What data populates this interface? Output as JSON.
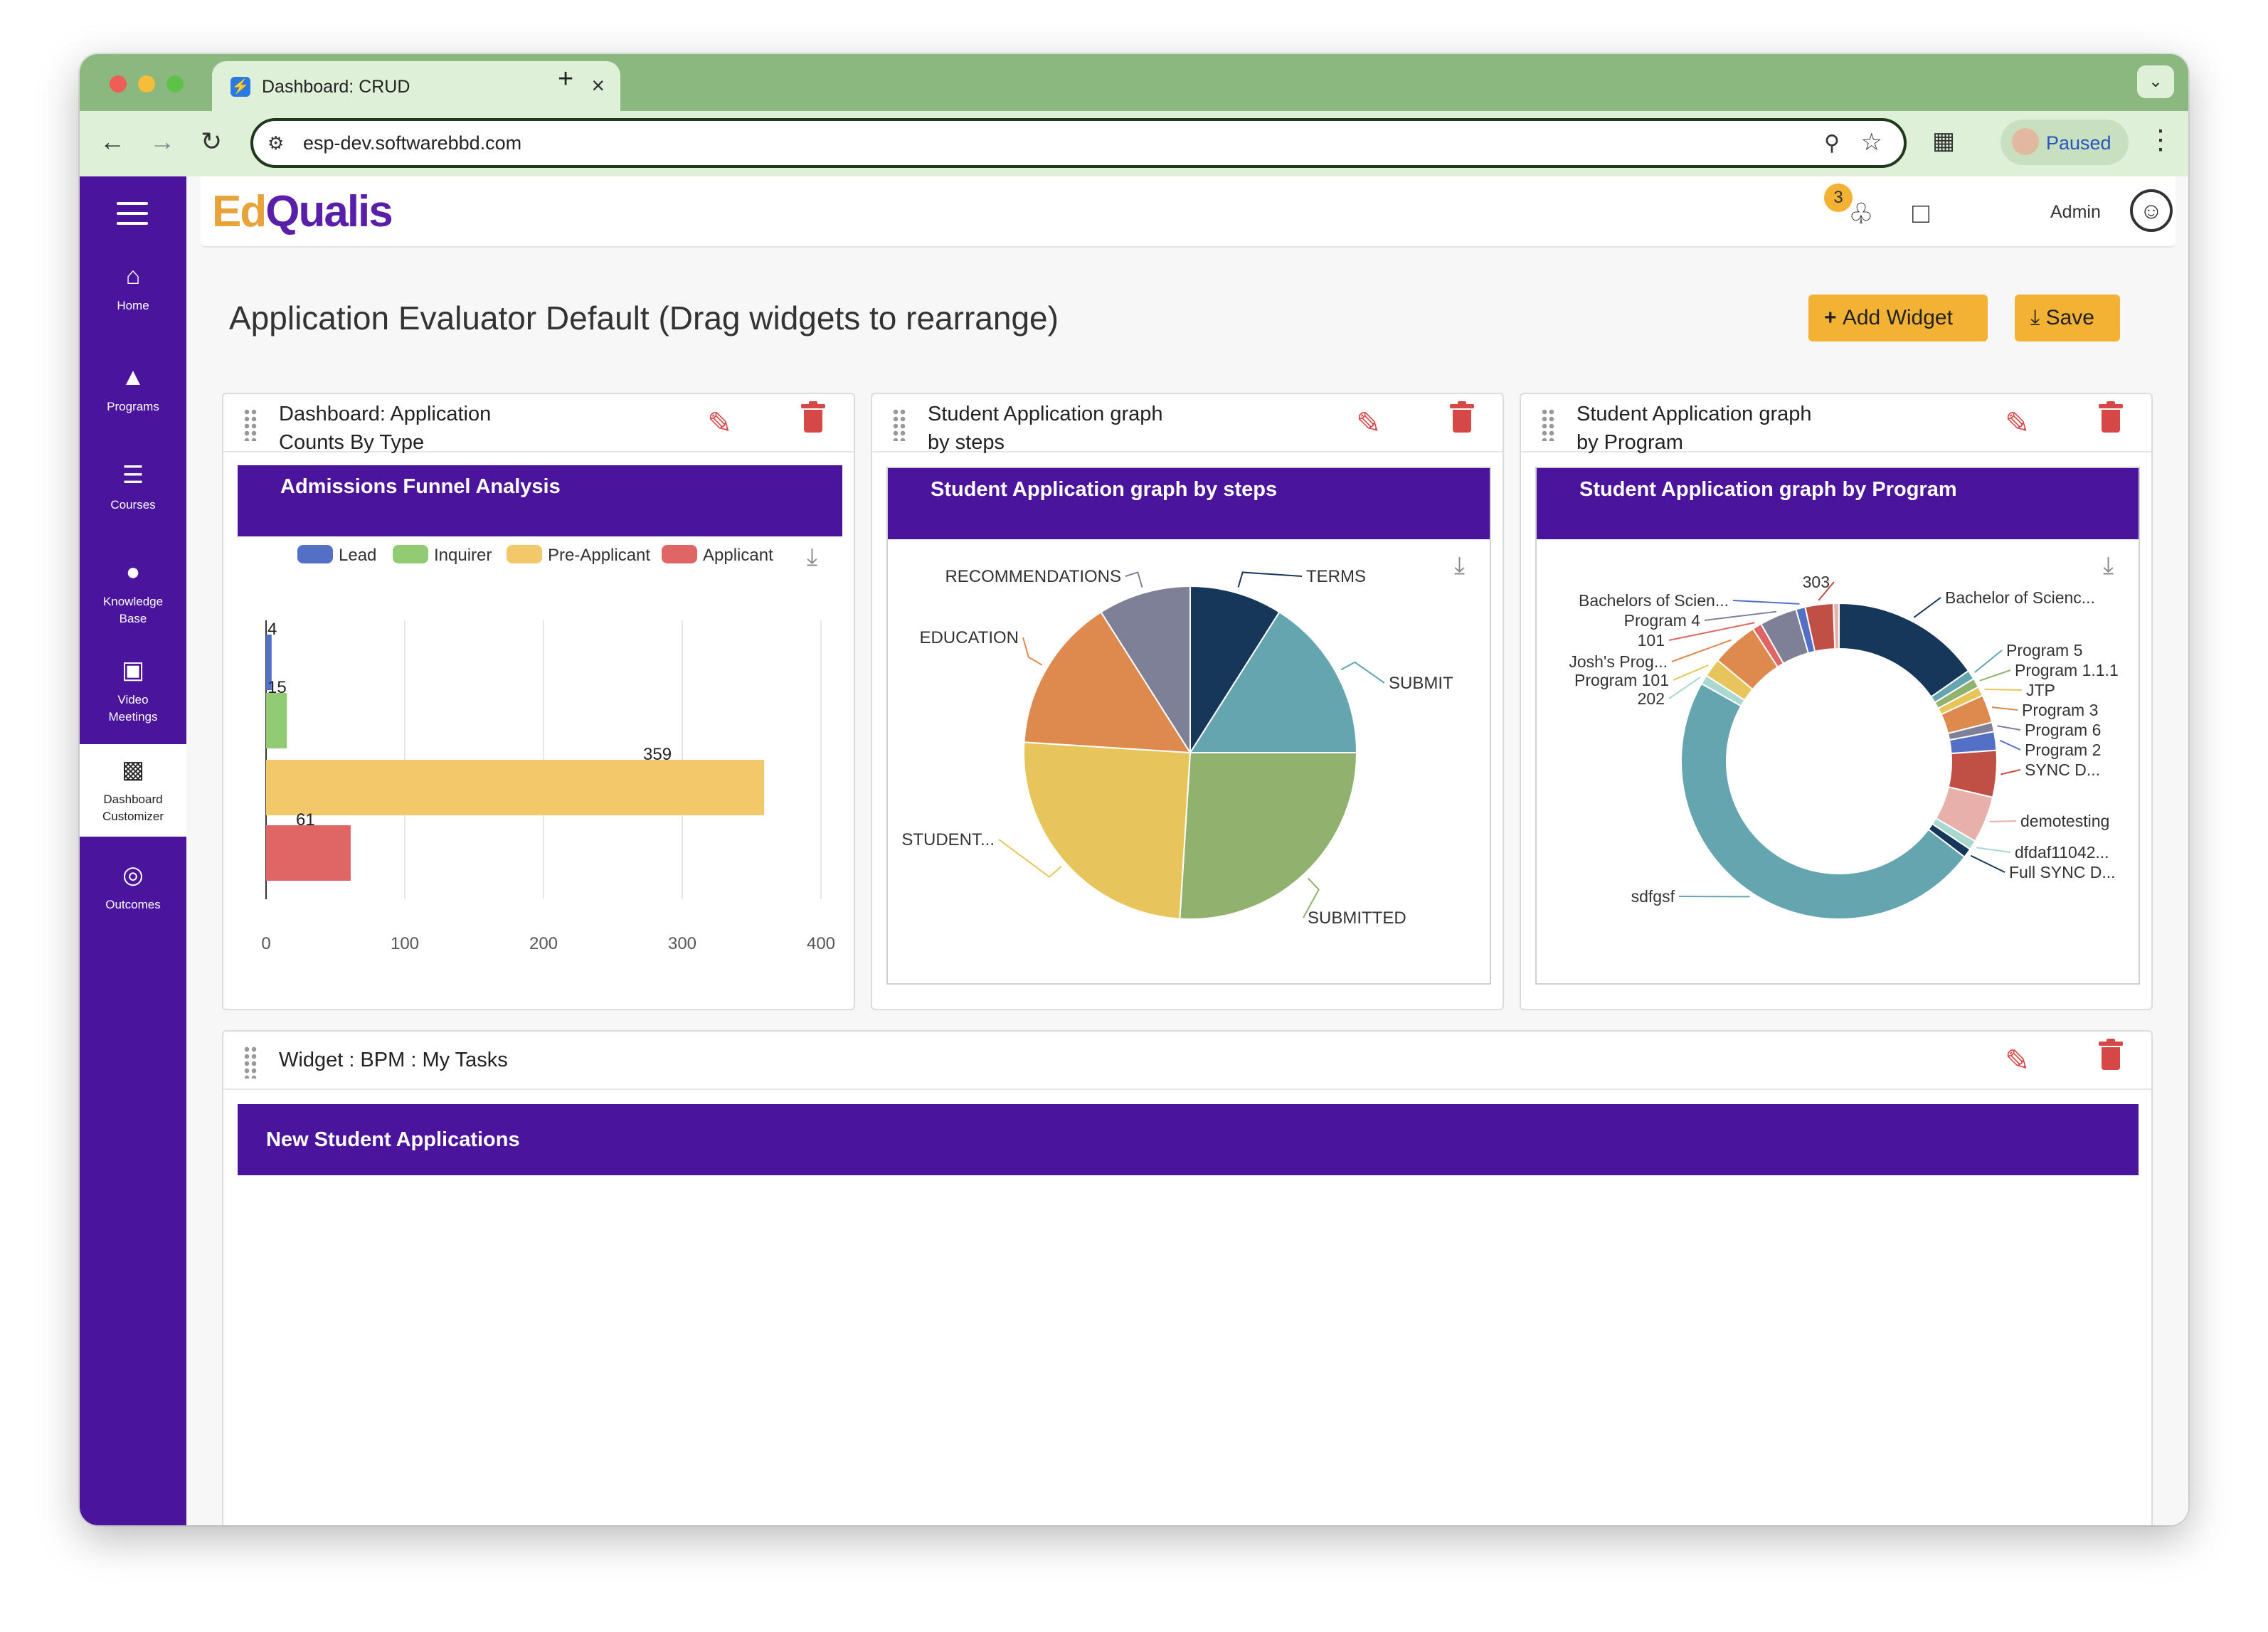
{
  "browser": {
    "tab_title": "Dashboard: CRUD",
    "url": "esp-dev.softwarebbd.com",
    "profile_status": "Paused"
  },
  "app": {
    "logo_part1": "Ed",
    "logo_part2": "Qualis",
    "notification_count": "3",
    "user_label": "Admin",
    "brand_color": "#4a149c",
    "accent_color": "#f3b234"
  },
  "sidebar": {
    "items": [
      {
        "label": "Home",
        "icon": "home-icon"
      },
      {
        "label": "Programs",
        "icon": "graduation-cap-icon"
      },
      {
        "label": "Courses",
        "icon": "layers-icon"
      },
      {
        "label": "Knowledge Base",
        "icon": "lightbulb-icon"
      },
      {
        "label": "Video Meetings",
        "icon": "video-meeting-icon"
      },
      {
        "label": "Dashboard Customizer",
        "icon": "monitor-icon"
      },
      {
        "label": "Outcomes",
        "icon": "target-icon"
      }
    ]
  },
  "page": {
    "title": "Application Evaluator Default  (Drag widgets to rearrange)",
    "add_widget_label": "Add Widget",
    "save_label": "Save"
  },
  "widgets": [
    {
      "title": "Dashboard: Application Counts By Type",
      "chart_title": "Admissions Funnel Analysis"
    },
    {
      "title": "Student Application graph by steps",
      "chart_title": "Student Application graph by steps"
    },
    {
      "title": "Student Application graph by Program",
      "chart_title": "Student Application graph by Program"
    },
    {
      "title": "Widget : BPM : My Tasks",
      "band_title": "New Student Applications"
    }
  ],
  "chart_data": [
    {
      "type": "bar",
      "orientation": "horizontal",
      "title": "Admissions Funnel Analysis",
      "series": [
        {
          "name": "Lead",
          "value": 4,
          "color": "#5470c6"
        },
        {
          "name": "Inquirer",
          "value": 15,
          "color": "#91cc75"
        },
        {
          "name": "Pre-Applicant",
          "value": 359,
          "color": "#f3c86b"
        },
        {
          "name": "Applicant",
          "value": 61,
          "color": "#e06666"
        }
      ],
      "xlim": [
        0,
        400
      ],
      "xticks": [
        0,
        100,
        200,
        300,
        400
      ],
      "grid": true,
      "legend": "top"
    },
    {
      "type": "pie",
      "title": "Student Application graph by steps",
      "slices": [
        {
          "label": "TERMS",
          "value": 9,
          "color": "#16375a"
        },
        {
          "label": "SUBMIT",
          "value": 16,
          "color": "#64a5b0"
        },
        {
          "label": "SUBMITTED",
          "value": 26,
          "color": "#91b26e"
        },
        {
          "label": "STUDENT...",
          "value": 25,
          "color": "#e8c55a"
        },
        {
          "label": "EDUCATION",
          "value": 15,
          "color": "#de8a4e"
        },
        {
          "label": "RECOMMENDATIONS",
          "value": 9,
          "color": "#7e8098"
        }
      ]
    },
    {
      "type": "pie",
      "variant": "donut",
      "title": "Student Application graph by Program",
      "slices": [
        {
          "label": "Bachelor of Scienc...",
          "value": 16,
          "color": "#16375a"
        },
        {
          "label": "Program 5",
          "value": 1,
          "color": "#64a5b0"
        },
        {
          "label": "Program 1.1.1",
          "value": 1,
          "color": "#91b26e"
        },
        {
          "label": "JTP",
          "value": 1,
          "color": "#e8c55a"
        },
        {
          "label": "Program 3",
          "value": 3,
          "color": "#de8a4e"
        },
        {
          "label": "Program 6",
          "value": 1,
          "color": "#7e8098"
        },
        {
          "label": "Program 2",
          "value": 2,
          "color": "#5470c6"
        },
        {
          "label": "SYNC D...",
          "value": 5,
          "color": "#c04f45"
        },
        {
          "label": "demotesting",
          "value": 5,
          "color": "#e8b0aa"
        },
        {
          "label": "dfdaf11042...",
          "value": 1,
          "color": "#a8d8d0"
        },
        {
          "label": "Full SYNC D...",
          "value": 1,
          "color": "#16375a"
        },
        {
          "label": "sdfgsf",
          "value": 50,
          "color": "#64a5b0"
        },
        {
          "label": "202",
          "value": 1,
          "color": "#a8d8d0"
        },
        {
          "label": "Program 101",
          "value": 2,
          "color": "#e8c55a"
        },
        {
          "label": "Josh's Prog...",
          "value": 5,
          "color": "#de8a4e"
        },
        {
          "label": "101",
          "value": 1,
          "color": "#e06666"
        },
        {
          "label": "Program 4",
          "value": 4,
          "color": "#7e8098"
        },
        {
          "label": "Bachelors of Scien...",
          "value": 1,
          "color": "#5470c6"
        },
        {
          "label": "303",
          "value": 3,
          "color": "#c04f45"
        },
        {
          "label": "",
          "value": 0.6,
          "color": "#e8b0aa"
        }
      ]
    }
  ]
}
